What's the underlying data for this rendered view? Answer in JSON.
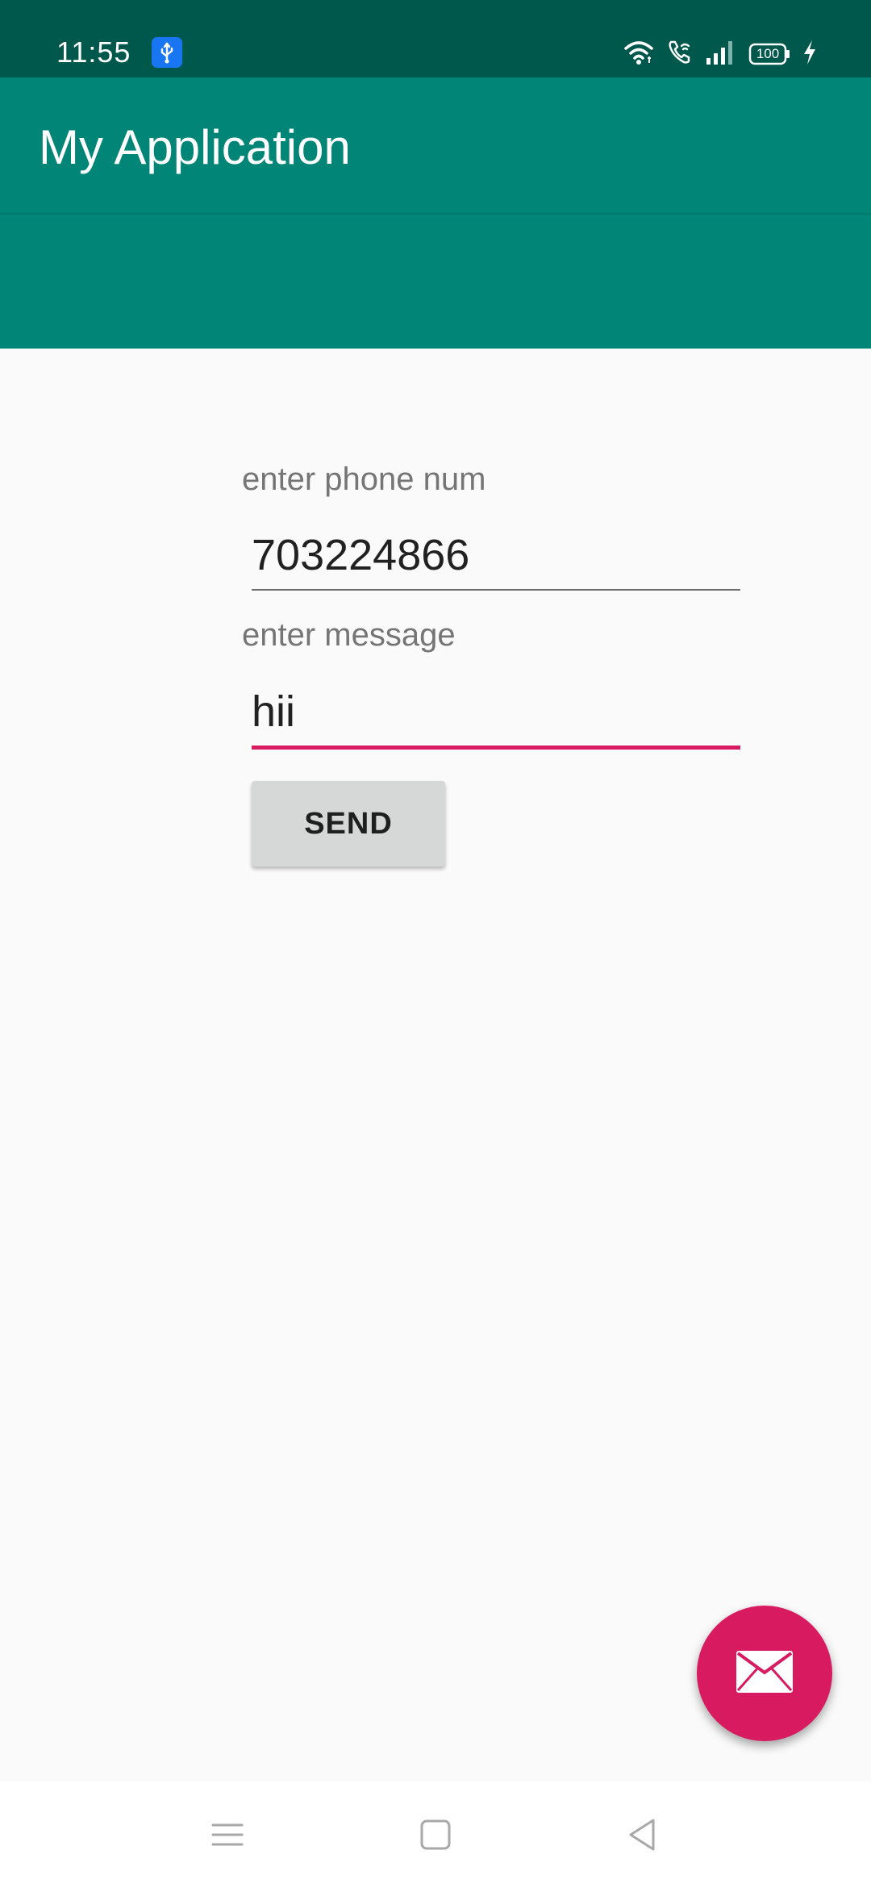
{
  "status_bar": {
    "time": "11:55",
    "battery": "100",
    "icons": [
      "usb-icon",
      "wifi-icon",
      "wifi-call-icon",
      "signal-icon",
      "battery-icon",
      "charging-icon"
    ],
    "background": "#00574b"
  },
  "app_bar": {
    "title": "My Application",
    "background": "#008577"
  },
  "form": {
    "phone_label": "enter phone num",
    "phone_value": "703224866",
    "message_label": "enter message",
    "message_value": "hii",
    "send_label": "SEND"
  },
  "fab": {
    "icon": "mail-icon",
    "color": "#d81b60"
  },
  "nav_bar": {
    "items": [
      "menu-icon",
      "home-icon",
      "back-icon"
    ]
  },
  "colors": {
    "accent": "#d81b60",
    "primary": "#008577",
    "primary_dark": "#00574b"
  }
}
